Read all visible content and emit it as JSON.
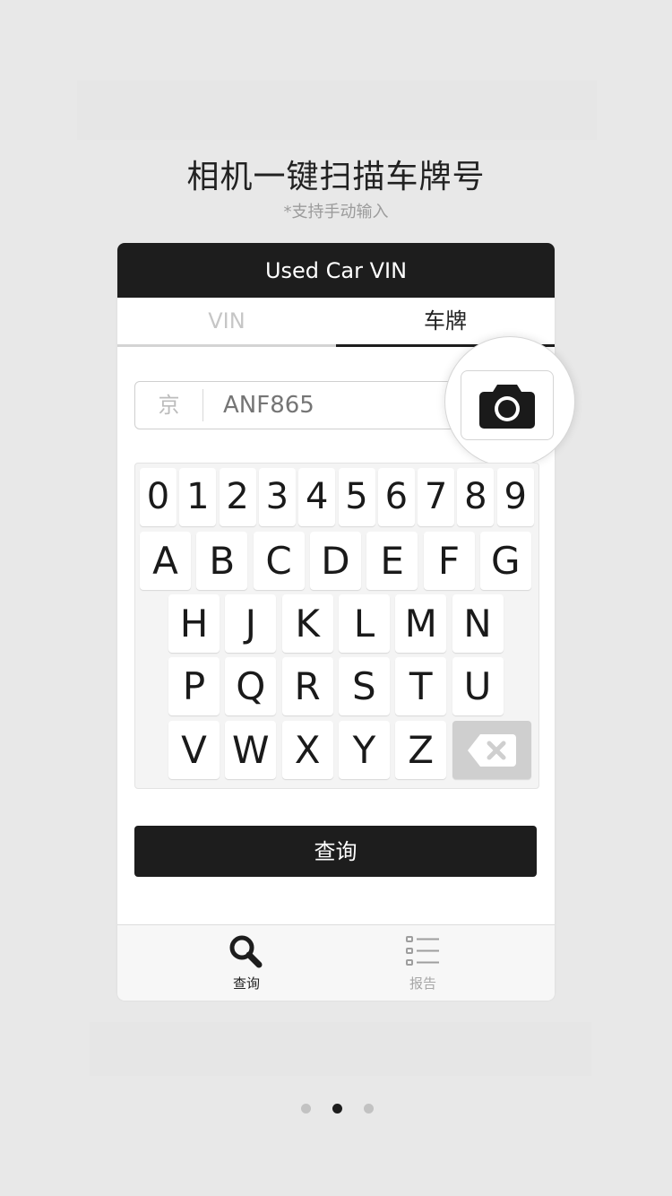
{
  "headline": "相机一键扫描车牌号",
  "subline": "*支持手动输入",
  "app": {
    "title": "Used Car VIN",
    "tabs": [
      {
        "label": "VIN",
        "active": false
      },
      {
        "label": "车牌",
        "active": true
      }
    ],
    "plate": {
      "province": "京",
      "placeholder": "ANF865"
    },
    "camera_icon": "camera-icon",
    "keyboard": {
      "row_digits": [
        "0",
        "1",
        "2",
        "3",
        "4",
        "5",
        "6",
        "7",
        "8",
        "9"
      ],
      "row_a": [
        "A",
        "B",
        "C",
        "D",
        "E",
        "F",
        "G"
      ],
      "row_h": [
        "H",
        "J",
        "K",
        "L",
        "M",
        "N"
      ],
      "row_p": [
        "P",
        "Q",
        "R",
        "S",
        "T",
        "U"
      ],
      "row_v": [
        "V",
        "W",
        "X",
        "Y",
        "Z"
      ],
      "delete_icon": "backspace-icon"
    },
    "query_button": "查询",
    "bottom_nav": [
      {
        "label": "查询",
        "icon": "search-icon",
        "active": true
      },
      {
        "label": "报告",
        "icon": "list-icon",
        "active": false
      }
    ]
  },
  "pager": {
    "count": 3,
    "active_index": 1
  },
  "colors": {
    "dark": "#1d1d1d",
    "background": "#e8e8e8",
    "pager_active": "#1d1d1d",
    "pager_inactive": "#c2c2c2"
  }
}
